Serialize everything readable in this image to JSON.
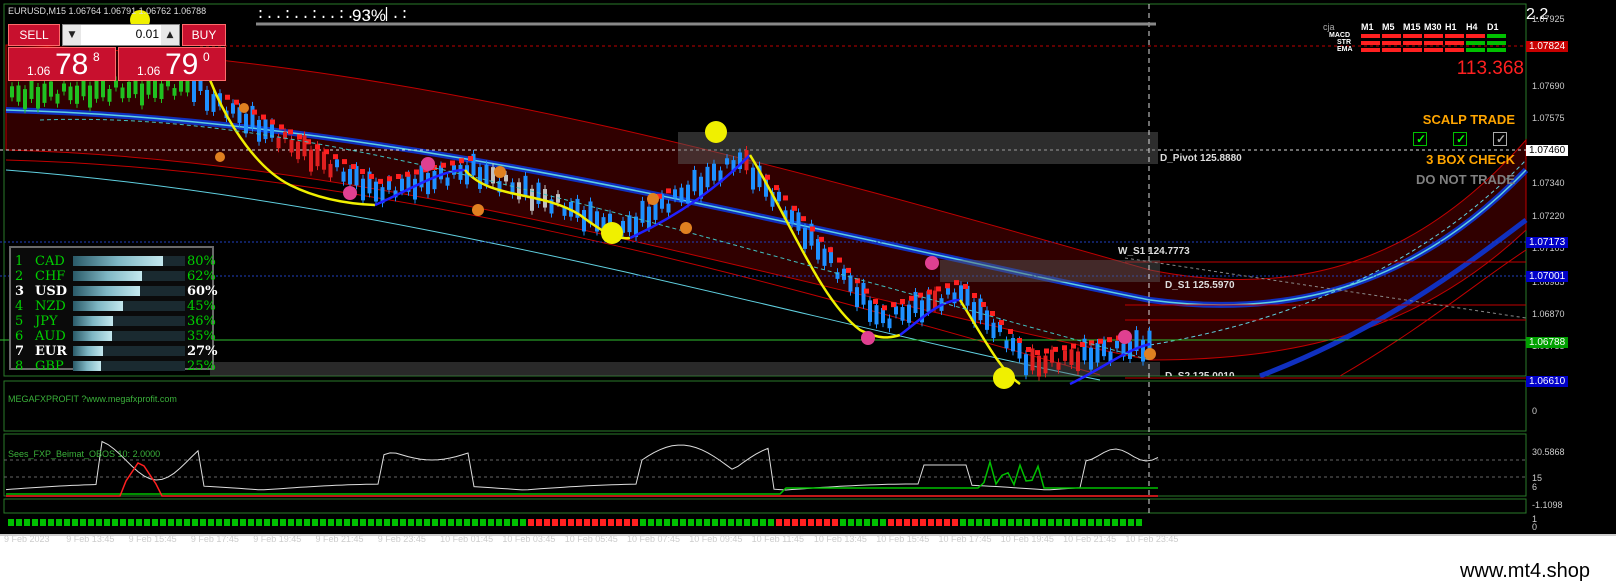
{
  "header": {
    "symbol_info": "EURUSD,M15  1.06764 1.06791 1.06762 1.06788",
    "progress_text": ":..:..:..:..:.|.:",
    "progress_percent": "93%",
    "spread_value": "2.2"
  },
  "trade_panel": {
    "sell_label": "SELL",
    "buy_label": "BUY",
    "lot_value": "0.01",
    "sell_price_prefix": "1.06",
    "sell_price_big": "78",
    "sell_price_sup": "8",
    "buy_price_prefix": "1.06",
    "buy_price_big": "79",
    "buy_price_sup": "0"
  },
  "indicators_top": {
    "timeframes": [
      "M1",
      "M5",
      "M15",
      "M30",
      "H1",
      "H4",
      "D1"
    ],
    "rows": [
      "MACD",
      "STR",
      "EMA"
    ],
    "corner": "cja",
    "big_value": "113.368",
    "colors": {
      "red": "#ff2020",
      "green": "#00c000",
      "buy_green": "#00ff00"
    }
  },
  "signals": {
    "scalp_trade": "SCALP TRADE",
    "box_check": "3 BOX CHECK",
    "do_not_trade": "DO NOT TRADE",
    "scalp_color": "#ffa500",
    "check_color": "#ffa500",
    "no_trade_color": "#808080"
  },
  "levels": {
    "d_pivot": "D_Pivot 125.8880",
    "w_s1": "W_S1 124.7773",
    "d_s1": "D_S1 125.5970",
    "d_s2": "D_S2 125.0010"
  },
  "price_axis": {
    "ticks": [
      "1.07925",
      "1.07690",
      "1.07575",
      "1.07340",
      "1.07220",
      "1.07105",
      "1.06985",
      "1.06870",
      "1.06755"
    ],
    "highlight_tags": [
      {
        "text": "1.07824",
        "bg": "#c80000",
        "fg": "#ffffff"
      },
      {
        "text": "1.07460",
        "bg": "#ffffff",
        "fg": "#000000"
      },
      {
        "text": "1.07173",
        "bg": "#0000c8",
        "fg": "#ffffff"
      },
      {
        "text": "1.07001",
        "bg": "#0000c8",
        "fg": "#ffffff"
      },
      {
        "text": "1.06788",
        "bg": "#00a000",
        "fg": "#ffffff"
      },
      {
        "text": "1.06610",
        "bg": "#0000c8",
        "fg": "#ffffff"
      }
    ]
  },
  "currency_strength": [
    {
      "rank": "1",
      "currency": "CAD",
      "percent": 80,
      "label": "80%"
    },
    {
      "rank": "2",
      "currency": "CHF",
      "percent": 62,
      "label": "62%"
    },
    {
      "rank": "3",
      "currency": "USD",
      "percent": 60,
      "label": "60%"
    },
    {
      "rank": "4",
      "currency": "NZD",
      "percent": 45,
      "label": "45%"
    },
    {
      "rank": "5",
      "currency": "JPY",
      "percent": 36,
      "label": "36%"
    },
    {
      "rank": "6",
      "currency": "AUD",
      "percent": 35,
      "label": "35%"
    },
    {
      "rank": "7",
      "currency": "EUR",
      "percent": 27,
      "label": "27%"
    },
    {
      "rank": "8",
      "currency": "GBP",
      "percent": 25,
      "label": "25%"
    }
  ],
  "sub_windows": {
    "megafx_label": "MEGAFXPROFIT ?www.megafxprofit.com",
    "megafx_axis": [
      "0"
    ],
    "oscillator_label": "Sees_FXP_Beimat_OBOS 10: 2.0000",
    "oscillator_axis": [
      "30.5868",
      "15",
      "6",
      "-1.1098"
    ],
    "bottom_axis": [
      "1",
      "0"
    ]
  },
  "time_axis": [
    "9 Feb 2023",
    "9 Feb 13:45",
    "9 Feb 15:45",
    "9 Feb 17:45",
    "9 Feb 19:45",
    "9 Feb 21:45",
    "9 Feb 23:45",
    "10 Feb 01:45",
    "10 Feb 03:45",
    "10 Feb 05:45",
    "10 Feb 07:45",
    "10 Feb 09:45",
    "10 Feb 11:45",
    "10 Feb 13:45",
    "10 Feb 15:45",
    "10 Feb 17:45",
    "10 Feb 19:45",
    "10 Feb 21:45",
    "10 Feb 23:45"
  ],
  "watermark": "www.mt4.shop"
}
